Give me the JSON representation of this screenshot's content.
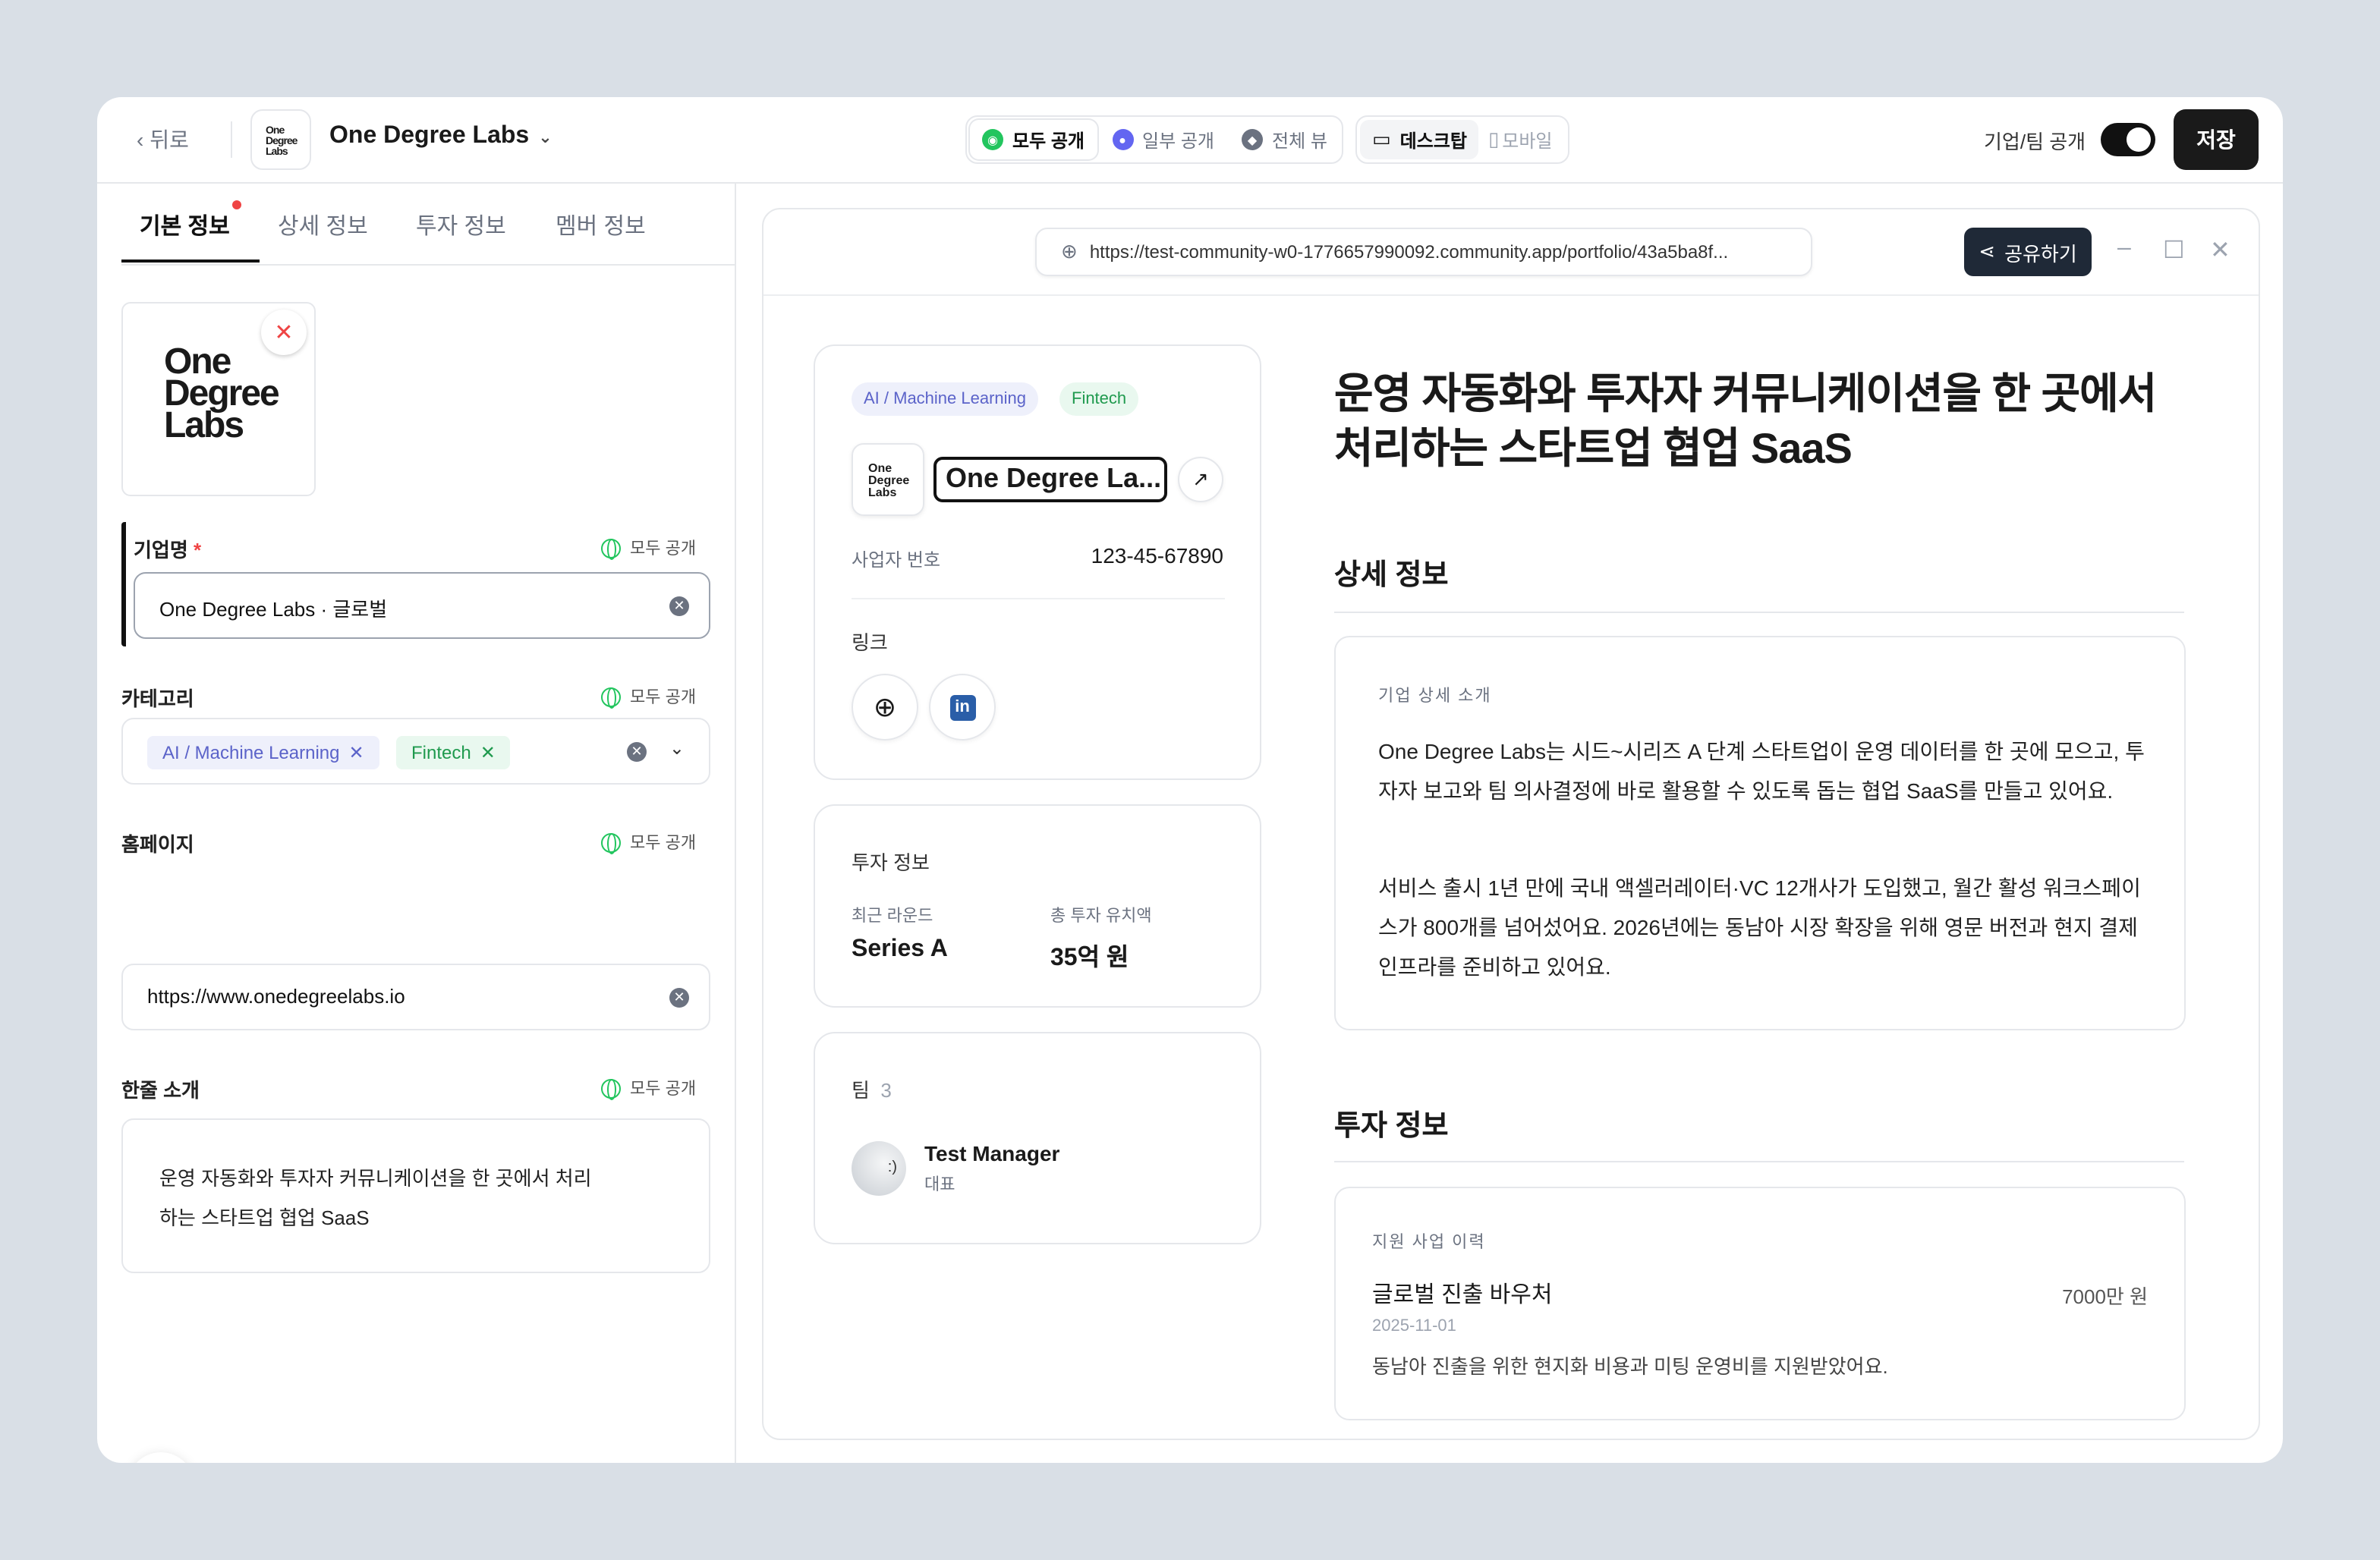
{
  "header": {
    "back_label": "뒤로",
    "company_name": "One Degree Labs",
    "visibility_options": [
      "모두 공개",
      "일부 공개",
      "전체 뷰"
    ],
    "device_options": [
      "데스크탑",
      "모바일"
    ],
    "public_toggle_label": "기업/팀 공개",
    "public_toggle_on": true,
    "save_label": "저장"
  },
  "logo": {
    "lines": [
      "One",
      "Degree",
      "Labs"
    ]
  },
  "tabs": [
    "기본 정보",
    "상세 정보",
    "투자 정보",
    "멤버 정보"
  ],
  "form": {
    "visibility_label": "모두 공개",
    "name": {
      "label": "기업명",
      "required": "*",
      "value": "One Degree Labs · 글로벌"
    },
    "category": {
      "label": "카테고리",
      "chips": [
        "AI / Machine Learning",
        "Fintech"
      ]
    },
    "homepage": {
      "label": "홈페이지",
      "value": "https://www.onedegreelabs.io"
    },
    "intro": {
      "label": "한줄 소개",
      "line1": "운영 자동화와 투자자 커뮤니케이션을 한 곳에서 처리",
      "line2": "하는 스타트업 협업 SaaS"
    }
  },
  "preview": {
    "url": "https://test-community-w0-1776657990092.community.app/portfolio/43a5ba8f...",
    "share_label": "공유하기",
    "tags": [
      "AI / Machine Learning",
      "Fintech"
    ],
    "company_name_short": "One Degree La...",
    "biz_no_label": "사업자 번호",
    "biz_no": "123-45-67890",
    "links_label": "링크",
    "invest": {
      "title": "투자 정보",
      "round_label": "최근 라운드",
      "round": "Series A",
      "total_label": "총 투자 유치액",
      "total": "35억 원"
    },
    "team": {
      "title": "팀",
      "count": "3",
      "member_name": "Test Manager",
      "member_role": "대표"
    },
    "headline": "운영 자동화와 투자자 커뮤니케이션을 한 곳에서 처리하는 스타트업 협업 SaaS",
    "detail": {
      "title": "상세 정보",
      "box_label": "기업 상세 소개",
      "p1": "One Degree Labs는 시드~시리즈 A 단계 스타트업이 운영 데이터를 한 곳에 모으고, 투자자 보고와 팀 의사결정에 바로 활용할 수 있도록 돕는 협업 SaaS를 만들고 있어요.",
      "p2": "서비스 출시 1년 만에 국내 액셀러레이터·VC 12개사가 도입했고, 월간 활성 워크스페이스가 800개를 넘어섰어요. 2026년에는 동남아 시장 확장을 위해 영문 버전과 현지 결제 인프라를 준비하고 있어요."
    },
    "investment": {
      "title": "투자 정보",
      "box_label": "지원 사업 이력",
      "program": "글로벌 진출 바우처",
      "amount": "7000만 원",
      "date": "2025-11-01",
      "desc": "동남아 진출을 위한 현지화 비용과 미팅 운영비를 지원받았어요."
    }
  },
  "colors": {
    "accent_green": "#22c55e",
    "accent_blue": "#5b63c9",
    "dark": "#1a1a1a",
    "required_red": "#ef4444"
  }
}
